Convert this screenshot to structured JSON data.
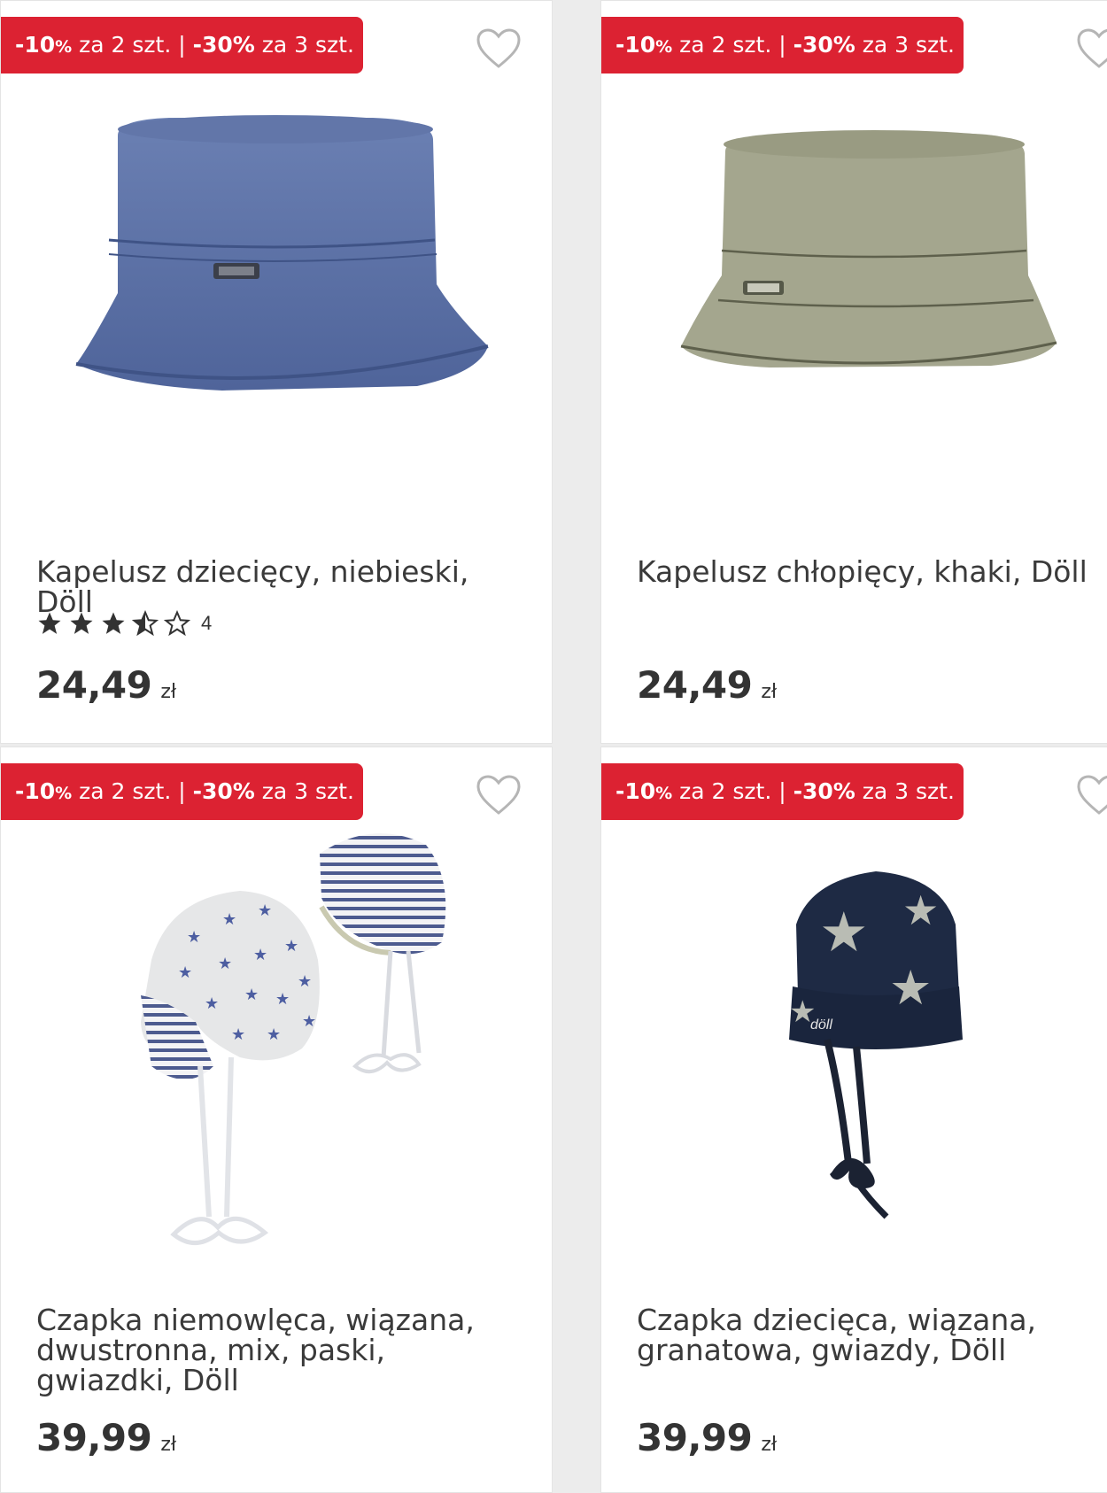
{
  "promo": {
    "part1_pct": "-10",
    "part1_sign": "%",
    "part1_text": " za 2 szt. | ",
    "part2_pct": "-30%",
    "part2_text": " za 3 szt."
  },
  "products": [
    {
      "title": "Kapelusz dziecięcy, niebieski, Döll",
      "rating_count": "4",
      "rating_value": 3.5,
      "price": "24,49",
      "currency": "zł",
      "image": "blue-bucket-hat"
    },
    {
      "title": "Kapelusz chłopięcy, khaki, Döll",
      "price": "24,49",
      "currency": "zł",
      "image": "khaki-bucket-hat"
    },
    {
      "title": "Czapka niemowlęca, wiązana, dwustronna, mix, paski, gwiazdki, Döll",
      "price": "39,99",
      "currency": "zł",
      "image": "reversible-baby-hat-stars-stripes"
    },
    {
      "title": "Czapka dziecięca, wiązana, granatowa, gwiazdy, Döll",
      "price": "39,99",
      "currency": "zł",
      "image": "navy-knit-hat-stars"
    }
  ],
  "colors": {
    "promo_red": "#dc2232",
    "blue_hat": "#5a6fa3",
    "khaki_hat": "#a3a58c",
    "navy_hat": "#1e2a44"
  }
}
